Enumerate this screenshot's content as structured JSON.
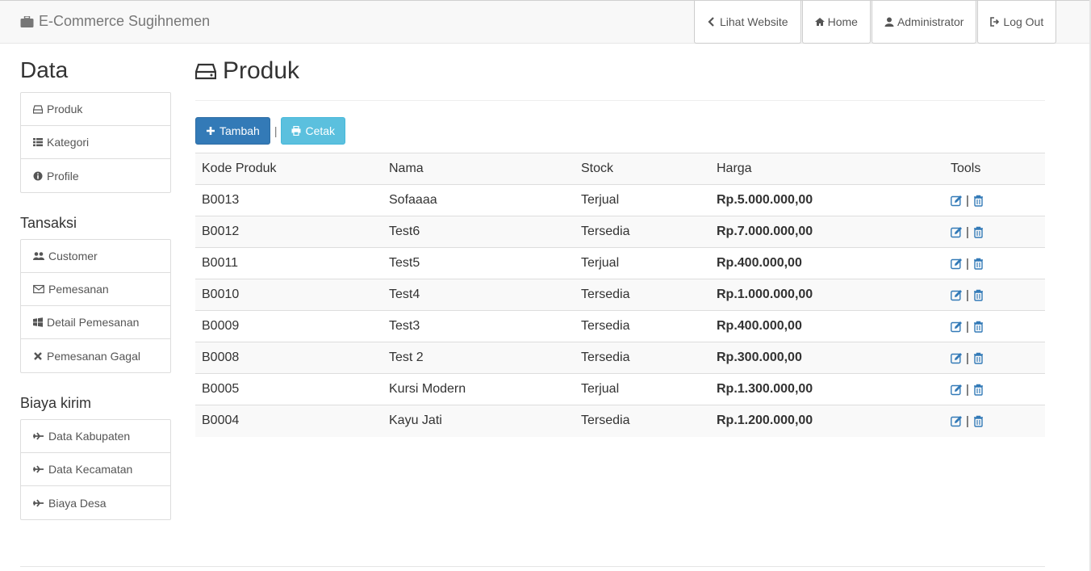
{
  "navbar": {
    "brand": "E-Commerce Sugihnemen",
    "brand_icon": "briefcase-icon",
    "buttons": [
      {
        "label": "Lihat Website",
        "icon": "chevron-left-icon"
      },
      {
        "label": "Home",
        "icon": "home-icon"
      },
      {
        "label": "Administrator",
        "icon": "user-icon"
      },
      {
        "label": "Log Out",
        "icon": "logout-icon"
      }
    ]
  },
  "sidebar": {
    "title": "Data",
    "data_items": [
      {
        "label": "Produk",
        "icon": "hdd-icon"
      },
      {
        "label": "Kategori",
        "icon": "list-icon"
      },
      {
        "label": "Profile",
        "icon": "info-icon"
      }
    ],
    "section_transaksi": "Tansaksi",
    "transaksi_items": [
      {
        "label": "Customer",
        "icon": "users-icon"
      },
      {
        "label": "Pemesanan",
        "icon": "envelope-icon"
      },
      {
        "label": "Detail Pemesanan",
        "icon": "windows-icon"
      },
      {
        "label": "Pemesanan Gagal",
        "icon": "times-icon"
      }
    ],
    "section_biaya": "Biaya kirim",
    "biaya_items": [
      {
        "label": "Data Kabupaten",
        "icon": "plane-icon"
      },
      {
        "label": "Data Kecamatan",
        "icon": "plane-icon"
      },
      {
        "label": "Biaya Desa",
        "icon": "plane-icon"
      }
    ]
  },
  "main": {
    "title": "Produk",
    "title_icon": "hdd-icon",
    "add_button": "Tambah",
    "separator": "|",
    "print_button": "Cetak",
    "columns": [
      "Kode Produk",
      "Nama",
      "Stock",
      "Harga",
      "Tools"
    ],
    "rows": [
      {
        "kode": "B0013",
        "nama": "Sofaaaa",
        "stock": "Terjual",
        "harga": "Rp.5.000.000,00"
      },
      {
        "kode": "B0012",
        "nama": "Test6",
        "stock": "Tersedia",
        "harga": "Rp.7.000.000,00"
      },
      {
        "kode": "B0011",
        "nama": "Test5",
        "stock": "Terjual",
        "harga": "Rp.400.000,00"
      },
      {
        "kode": "B0010",
        "nama": "Test4",
        "stock": "Tersedia",
        "harga": "Rp.1.000.000,00"
      },
      {
        "kode": "B0009",
        "nama": "Test3",
        "stock": "Tersedia",
        "harga": "Rp.400.000,00"
      },
      {
        "kode": "B0008",
        "nama": "Test 2",
        "stock": "Tersedia",
        "harga": "Rp.300.000,00"
      },
      {
        "kode": "B0005",
        "nama": "Kursi Modern",
        "stock": "Terjual",
        "harga": "Rp.1.300.000,00"
      },
      {
        "kode": "B0004",
        "nama": "Kayu Jati",
        "stock": "Tersedia",
        "harga": "Rp.1.200.000,00"
      }
    ],
    "tools_separator": "|"
  },
  "colors": {
    "primary": "#337ab7",
    "info": "#5bc0de",
    "navbar_bg": "#f8f8f8"
  }
}
